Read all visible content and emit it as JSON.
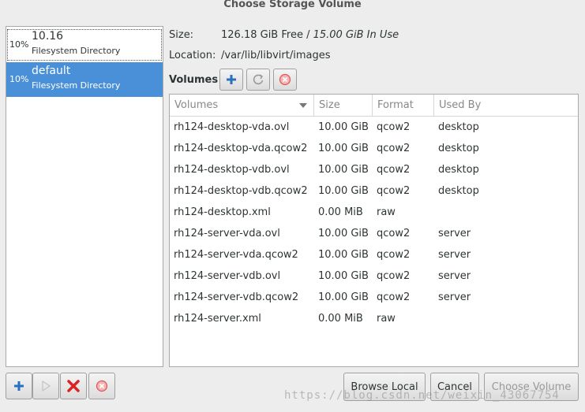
{
  "window": {
    "title": "Choose Storage Volume"
  },
  "pools": [
    {
      "percent": "10%",
      "name": "10.16",
      "type": "Filesystem Directory",
      "selected": false
    },
    {
      "percent": "10%",
      "name": "default",
      "type": "Filesystem Directory",
      "selected": true
    }
  ],
  "info": {
    "size_label": "Size:",
    "size_free": "126.18 GiB Free / ",
    "size_inuse": "15.00 GiB In Use",
    "location_label": "Location:",
    "location_value": "/var/lib/libvirt/images"
  },
  "volumes": {
    "title": "Volumes",
    "toolbar": {
      "add_icon": "plus-icon",
      "refresh_icon": "refresh-icon",
      "delete_icon": "stop-icon"
    },
    "columns": [
      "Volumes",
      "Size",
      "Format",
      "Used By"
    ],
    "rows": [
      {
        "name": "rh124-desktop-vda.ovl",
        "size": "10.00 GiB",
        "format": "qcow2",
        "used_by": "desktop"
      },
      {
        "name": "rh124-desktop-vda.qcow2",
        "size": "10.00 GiB",
        "format": "qcow2",
        "used_by": "desktop"
      },
      {
        "name": "rh124-desktop-vdb.ovl",
        "size": "10.00 GiB",
        "format": "qcow2",
        "used_by": "desktop"
      },
      {
        "name": "rh124-desktop-vdb.qcow2",
        "size": "10.00 GiB",
        "format": "qcow2",
        "used_by": "desktop"
      },
      {
        "name": "rh124-desktop.xml",
        "size": "0.00 MiB",
        "format": "raw",
        "used_by": ""
      },
      {
        "name": "rh124-server-vda.ovl",
        "size": "10.00 GiB",
        "format": "qcow2",
        "used_by": "server"
      },
      {
        "name": "rh124-server-vda.qcow2",
        "size": "10.00 GiB",
        "format": "qcow2",
        "used_by": "server"
      },
      {
        "name": "rh124-server-vdb.ovl",
        "size": "10.00 GiB",
        "format": "qcow2",
        "used_by": "server"
      },
      {
        "name": "rh124-server-vdb.qcow2",
        "size": "10.00 GiB",
        "format": "qcow2",
        "used_by": "server"
      },
      {
        "name": "rh124-server.xml",
        "size": "0.00 MiB",
        "format": "raw",
        "used_by": ""
      }
    ]
  },
  "pool_toolbar": {
    "add_icon": "plus-icon",
    "start_icon": "play-icon",
    "delete_icon": "delete-x-icon",
    "stop_icon": "stop-icon"
  },
  "buttons": {
    "browse_local": "Browse Local",
    "cancel": "Cancel",
    "choose_volume": "Choose Volume"
  },
  "watermark": "https://blog.csdn.net/weixin_43067754",
  "colors": {
    "selection": "#4a90d9",
    "add_blue": "#2a6fc0",
    "delete_red": "#d22"
  }
}
